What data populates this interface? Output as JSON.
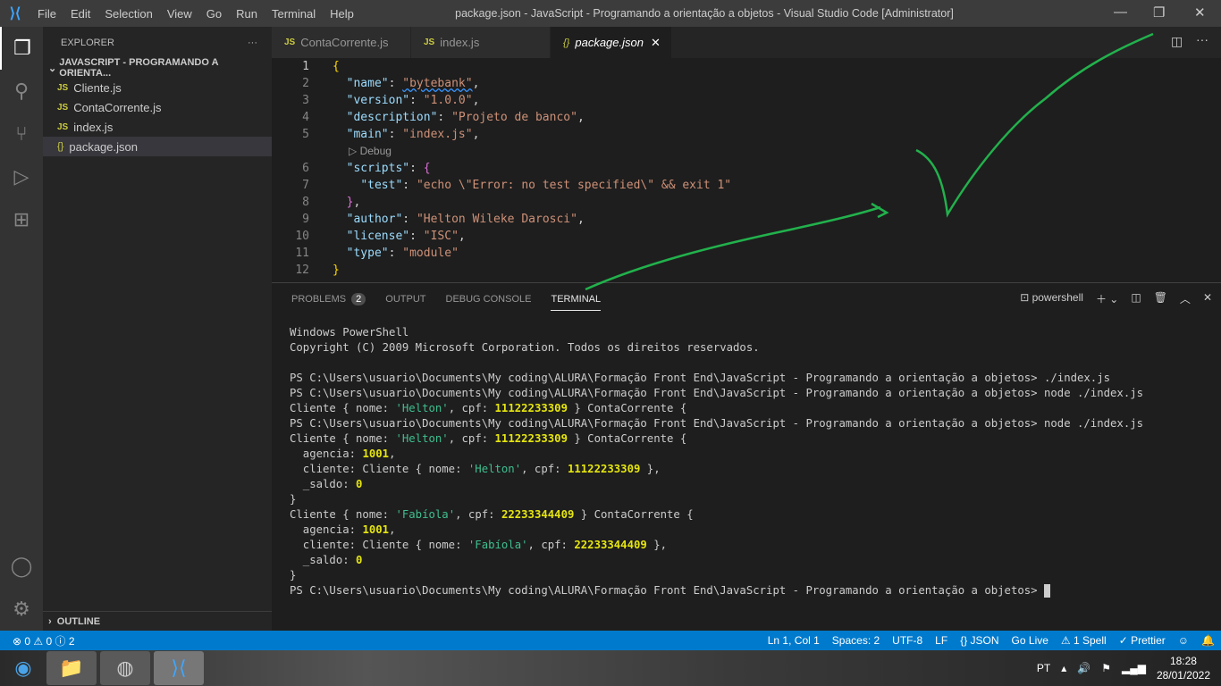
{
  "titlebar": {
    "menu": [
      "File",
      "Edit",
      "Selection",
      "View",
      "Go",
      "Run",
      "Terminal",
      "Help"
    ],
    "title": "package.json - JavaScript - Programando a orientação a objetos - Visual Studio Code [Administrator]"
  },
  "sidebar": {
    "header": "EXPLORER",
    "more": "···",
    "folder": "JAVASCRIPT - PROGRAMANDO A ORIENTA...",
    "files": [
      {
        "name": "Cliente.js",
        "icon": "JS"
      },
      {
        "name": "ContaCorrente.js",
        "icon": "JS"
      },
      {
        "name": "index.js",
        "icon": "JS"
      },
      {
        "name": "package.json",
        "icon": "{}"
      }
    ],
    "outline": "OUTLINE"
  },
  "tabs": [
    {
      "label": "ContaCorrente.js",
      "icon": "JS"
    },
    {
      "label": "index.js",
      "icon": "JS"
    },
    {
      "label": "package.json",
      "icon": "{}",
      "close": "✕"
    }
  ],
  "editor": {
    "codelens": "▷ Debug",
    "lines": [
      [
        [
          "b1",
          "{"
        ]
      ],
      [
        [
          "p",
          "  "
        ],
        [
          "k",
          "\"name\""
        ],
        [
          "p",
          ": "
        ],
        [
          "s",
          "\"bytebank\""
        ],
        [
          "p",
          ","
        ]
      ],
      [
        [
          "p",
          "  "
        ],
        [
          "k",
          "\"version\""
        ],
        [
          "p",
          ": "
        ],
        [
          "s",
          "\"1.0.0\""
        ],
        [
          "p",
          ","
        ]
      ],
      [
        [
          "p",
          "  "
        ],
        [
          "k",
          "\"description\""
        ],
        [
          "p",
          ": "
        ],
        [
          "s",
          "\"Projeto de banco\""
        ],
        [
          "p",
          ","
        ]
      ],
      [
        [
          "p",
          "  "
        ],
        [
          "k",
          "\"main\""
        ],
        [
          "p",
          ": "
        ],
        [
          "s",
          "\"index.js\""
        ],
        [
          "p",
          ","
        ]
      ],
      [
        [
          "p",
          "  "
        ],
        [
          "k",
          "\"scripts\""
        ],
        [
          "p",
          ": "
        ],
        [
          "b2",
          "{"
        ]
      ],
      [
        [
          "p",
          "    "
        ],
        [
          "k",
          "\"test\""
        ],
        [
          "p",
          ": "
        ],
        [
          "s",
          "\"echo \\\"Error: no test specified\\\" && exit 1\""
        ]
      ],
      [
        [
          "p",
          "  "
        ],
        [
          "b2",
          "}"
        ],
        [
          "p",
          ","
        ]
      ],
      [
        [
          "p",
          "  "
        ],
        [
          "k",
          "\"author\""
        ],
        [
          "p",
          ": "
        ],
        [
          "s",
          "\"Helton Wileke Darosci\""
        ],
        [
          "p",
          ","
        ]
      ],
      [
        [
          "p",
          "  "
        ],
        [
          "k",
          "\"license\""
        ],
        [
          "p",
          ": "
        ],
        [
          "s",
          "\"ISC\""
        ],
        [
          "p",
          ","
        ]
      ],
      [
        [
          "p",
          "  "
        ],
        [
          "k",
          "\"type\""
        ],
        [
          "p",
          ": "
        ],
        [
          "s",
          "\"module\""
        ]
      ],
      [
        [
          "b1",
          "}"
        ]
      ]
    ]
  },
  "panel": {
    "tabs": [
      "PROBLEMS",
      "OUTPUT",
      "DEBUG CONSOLE",
      "TERMINAL"
    ],
    "problems_count": "2",
    "shell": "powershell"
  },
  "terminal": [
    [
      [
        "",
        "Windows PowerShell"
      ]
    ],
    [
      [
        "",
        "Copyright (C) 2009 Microsoft Corporation. Todos os direitos reservados."
      ]
    ],
    [
      [
        "",
        ""
      ]
    ],
    [
      [
        "",
        "PS C:\\Users\\usuario\\Documents\\My coding\\ALURA\\Formação Front End\\JavaScript - Programando a orientação a objetos> ./index.js"
      ]
    ],
    [
      [
        "",
        "PS C:\\Users\\usuario\\Documents\\My coding\\ALURA\\Formação Front End\\JavaScript - Programando a orientação a objetos> node ./index.js"
      ]
    ],
    [
      [
        "",
        "Cliente { nome: "
      ],
      [
        "t-str",
        "'Helton'"
      ],
      [
        "",
        ", cpf: "
      ],
      [
        "t-num",
        "11122233309"
      ],
      [
        "",
        " } ContaCorrente {"
      ]
    ],
    [
      [
        "",
        "PS C:\\Users\\usuario\\Documents\\My coding\\ALURA\\Formação Front End\\JavaScript - Programando a orientação a objetos> node ./index.js"
      ]
    ],
    [
      [
        "",
        "Cliente { nome: "
      ],
      [
        "t-str",
        "'Helton'"
      ],
      [
        "",
        ", cpf: "
      ],
      [
        "t-num",
        "11122233309"
      ],
      [
        "",
        " } ContaCorrente {"
      ]
    ],
    [
      [
        "",
        "  agencia: "
      ],
      [
        "t-num",
        "1001"
      ],
      [
        "",
        ","
      ]
    ],
    [
      [
        "",
        "  cliente: Cliente { nome: "
      ],
      [
        "t-str",
        "'Helton'"
      ],
      [
        "",
        ", cpf: "
      ],
      [
        "t-num",
        "11122233309"
      ],
      [
        "",
        " },"
      ]
    ],
    [
      [
        "",
        "  _saldo: "
      ],
      [
        "t-num",
        "0"
      ]
    ],
    [
      [
        "",
        "}"
      ]
    ],
    [
      [
        "",
        "Cliente { nome: "
      ],
      [
        "t-str",
        "'Fabíola'"
      ],
      [
        "",
        ", cpf: "
      ],
      [
        "t-num",
        "22233344409"
      ],
      [
        "",
        " } ContaCorrente {"
      ]
    ],
    [
      [
        "",
        "  agencia: "
      ],
      [
        "t-num",
        "1001"
      ],
      [
        "",
        ","
      ]
    ],
    [
      [
        "",
        "  cliente: Cliente { nome: "
      ],
      [
        "t-str",
        "'Fabíola'"
      ],
      [
        "",
        ", cpf: "
      ],
      [
        "t-num",
        "22233344409"
      ],
      [
        "",
        " },"
      ]
    ],
    [
      [
        "",
        "  _saldo: "
      ],
      [
        "t-num",
        "0"
      ]
    ],
    [
      [
        "",
        "}"
      ]
    ],
    [
      [
        "",
        "PS C:\\Users\\usuario\\Documents\\My coding\\ALURA\\Formação Front End\\JavaScript - Programando a orientação a objetos> "
      ]
    ]
  ],
  "status": {
    "left": "⊗ 0 ⚠ 0 ⓘ 2",
    "items": [
      "Ln 1, Col 1",
      "Spaces: 2",
      "UTF-8",
      "LF",
      "{} JSON",
      "Go Live",
      "⚠ 1 Spell",
      "✓ Prettier"
    ]
  },
  "taskbar": {
    "lang": "PT",
    "time": "18:28",
    "date": "28/01/2022"
  },
  "colors": {
    "accent": "#007acc",
    "annotation": "#22b14c"
  }
}
